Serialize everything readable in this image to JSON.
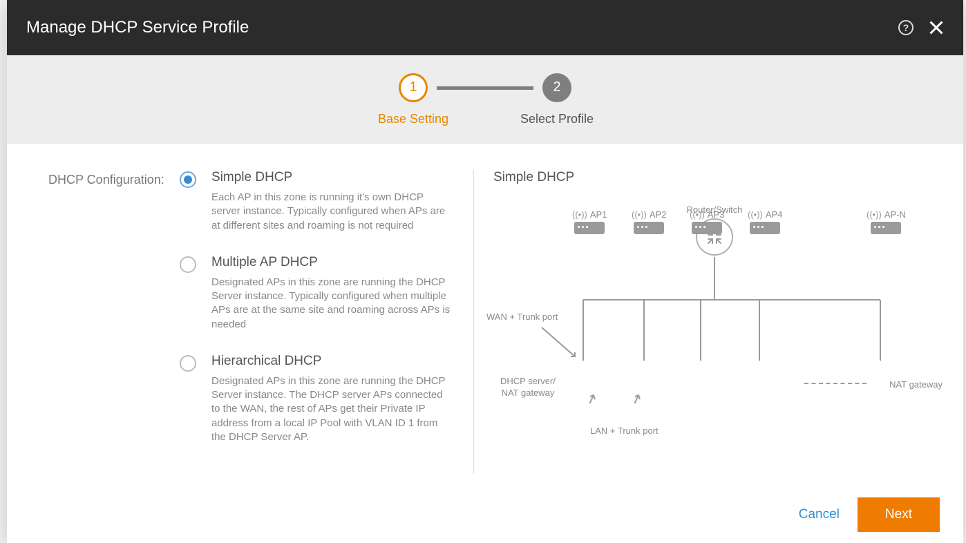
{
  "modal": {
    "title": "Manage DHCP Service Profile"
  },
  "stepper": {
    "steps": [
      {
        "num": "1",
        "label": "Base Setting"
      },
      {
        "num": "2",
        "label": "Select Profile"
      }
    ]
  },
  "field_label": "DHCP Configuration:",
  "options": [
    {
      "title": "Simple DHCP",
      "desc": "Each AP in this zone is running it's own DHCP server instance. Typically configured when APs are at different sites and roaming is not required",
      "selected": true
    },
    {
      "title": "Multiple AP DHCP",
      "desc": "Designated APs in this zone are running the DHCP Server instance. Typically configured when multiple APs are at the same site and roaming across APs is needed",
      "selected": false
    },
    {
      "title": "Hierarchical DHCP",
      "desc": "Designated APs in this zone are running the DHCP Server instance. The DHCP server APs connected to the WAN, the rest of APs get their Private IP address from a local IP Pool with VLAN ID 1 from the DHCP Server AP.",
      "selected": false
    }
  ],
  "preview": {
    "title": "Simple DHCP",
    "router_label": "Router/Switch",
    "wan_label": "WAN + Trunk port",
    "dhcp_label": "DHCP server/ NAT gateway",
    "nat_label": "NAT gateway",
    "lan_label": "LAN + Trunk port",
    "aps": [
      "AP1",
      "AP2",
      "AP3",
      "AP4",
      "AP-N"
    ]
  },
  "footer": {
    "cancel": "Cancel",
    "next": "Next"
  }
}
